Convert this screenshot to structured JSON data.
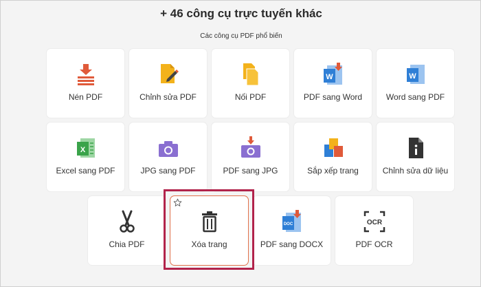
{
  "header": {
    "title": "+ 46 công cụ trực tuyến khác",
    "subtitle": "Các công cụ PDF phổ biến"
  },
  "tools": [
    {
      "label": "Nén PDF",
      "icon": "compress-icon"
    },
    {
      "label": "Chỉnh sửa PDF",
      "icon": "edit-pdf-icon"
    },
    {
      "label": "Nối PDF",
      "icon": "merge-icon"
    },
    {
      "label": "PDF sang Word",
      "icon": "pdf-to-word-icon"
    },
    {
      "label": "Word sang PDF",
      "icon": "word-icon"
    },
    {
      "label": "Excel sang PDF",
      "icon": "excel-icon"
    },
    {
      "label": "JPG sang PDF",
      "icon": "camera-icon"
    },
    {
      "label": "PDF sang JPG",
      "icon": "camera-download-icon"
    },
    {
      "label": "Sắp xếp trang",
      "icon": "organize-pages-icon"
    },
    {
      "label": "Chỉnh sửa dữ liệu",
      "icon": "info-document-icon"
    },
    {
      "label": "Chia PDF",
      "icon": "scissors-icon"
    },
    {
      "label": "Xóa trang",
      "icon": "trash-icon"
    },
    {
      "label": "PDF sang DOCX",
      "icon": "pdf-to-docx-icon"
    },
    {
      "label": "PDF OCR",
      "icon": "ocr-icon"
    }
  ],
  "colors": {
    "accent_red": "#e05a3a",
    "word_blue": "#2f7fd6",
    "excel_green": "#3aa34a",
    "file_yellow": "#f3b21b",
    "camera_purple": "#8a6fd1",
    "highlight_border": "#b2234b"
  }
}
